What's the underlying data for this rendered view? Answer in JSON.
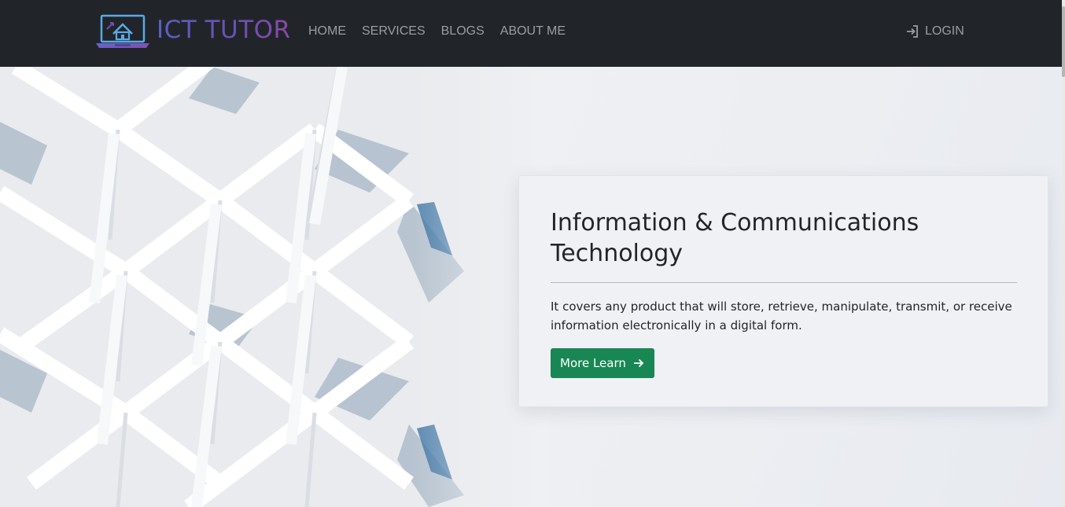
{
  "navbar": {
    "brand": "ICT TUTOR",
    "links": [
      "HOME",
      "SERVICES",
      "BLOGS",
      "ABOUT ME"
    ],
    "login": "LOGIN"
  },
  "hero": {
    "title": "Information & Communications Technology",
    "description": "It covers any product that will store, retrieve, manipulate, transmit, or receive information electronically in a digital form.",
    "button": "More Learn"
  },
  "icons": {
    "brand": "laptop-home-icon",
    "login": "sign-in-icon",
    "button": "arrow-right-icon"
  },
  "colors": {
    "navbar": "#212529",
    "nav_text": "#9a9da1",
    "brand": "#5b5aa8",
    "button": "#198754"
  }
}
